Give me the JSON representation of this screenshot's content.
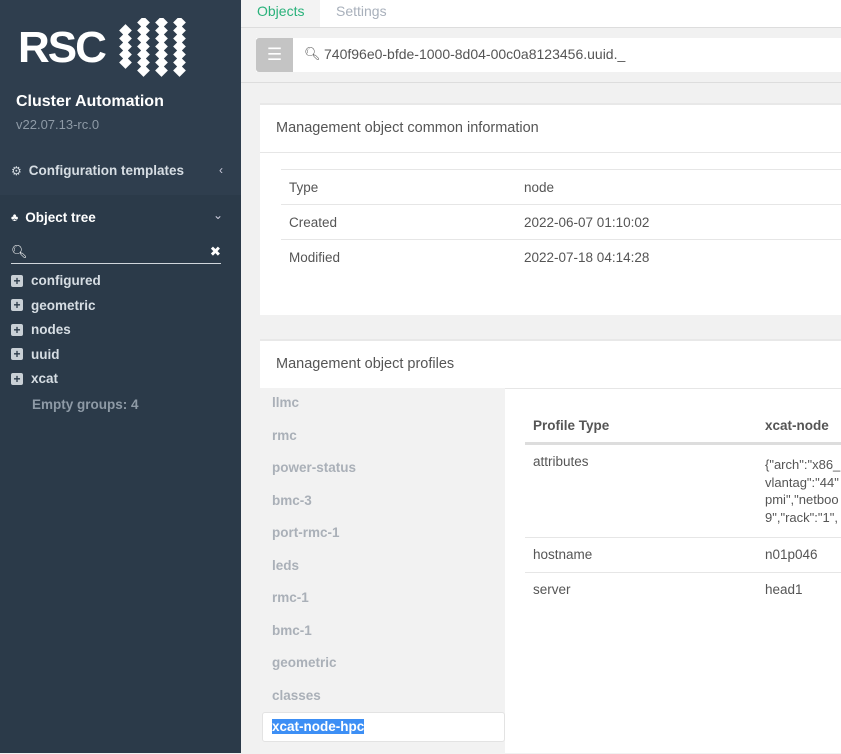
{
  "sidebar": {
    "logo_text": "RSC",
    "app_title": "Cluster Automation",
    "version": "v22.07.13-rc.0",
    "config_templates": "Configuration templates",
    "object_tree": "Object tree",
    "tree_items": [
      "configured",
      "geometric",
      "nodes",
      "uuid",
      "xcat"
    ],
    "empty_groups": "Empty groups: 4"
  },
  "tabs": [
    {
      "label": "Objects",
      "active": true
    },
    {
      "label": "Settings",
      "active": false
    }
  ],
  "search": {
    "value": "740f96e0-bfde-1000-8d04-00c0a8123456.uuid._"
  },
  "common": {
    "title": "Management object common information",
    "rows": [
      {
        "k": "Type",
        "v": "node"
      },
      {
        "k": "Created",
        "v": "2022-06-07 01:10:02"
      },
      {
        "k": "Modified",
        "v": "2022-07-18 04:14:28"
      }
    ]
  },
  "profiles": {
    "title": "Management object profiles",
    "list": [
      "llmc",
      "rmc",
      "power-status",
      "bmc-3",
      "port-rmc-1",
      "leds",
      "rmc-1",
      "bmc-1",
      "geometric",
      "classes"
    ],
    "selected": "xcat-node-hpc",
    "table": {
      "headers": [
        "Profile Type",
        "xcat-node"
      ],
      "attributes_label": "attributes",
      "attributes_lines": [
        "{\"arch\":\"x86_",
        "vlantag\":\"44\"",
        "pmi\",\"netboo",
        "9\",\"rack\":\"1\","
      ],
      "rows": [
        {
          "k": "hostname",
          "v": "n01p046"
        },
        {
          "k": "server",
          "v": "head1"
        }
      ]
    }
  },
  "colors": {
    "sidebar": "#2b3a49",
    "accent": "#2ab27b",
    "selection": "#3d8ff5"
  }
}
